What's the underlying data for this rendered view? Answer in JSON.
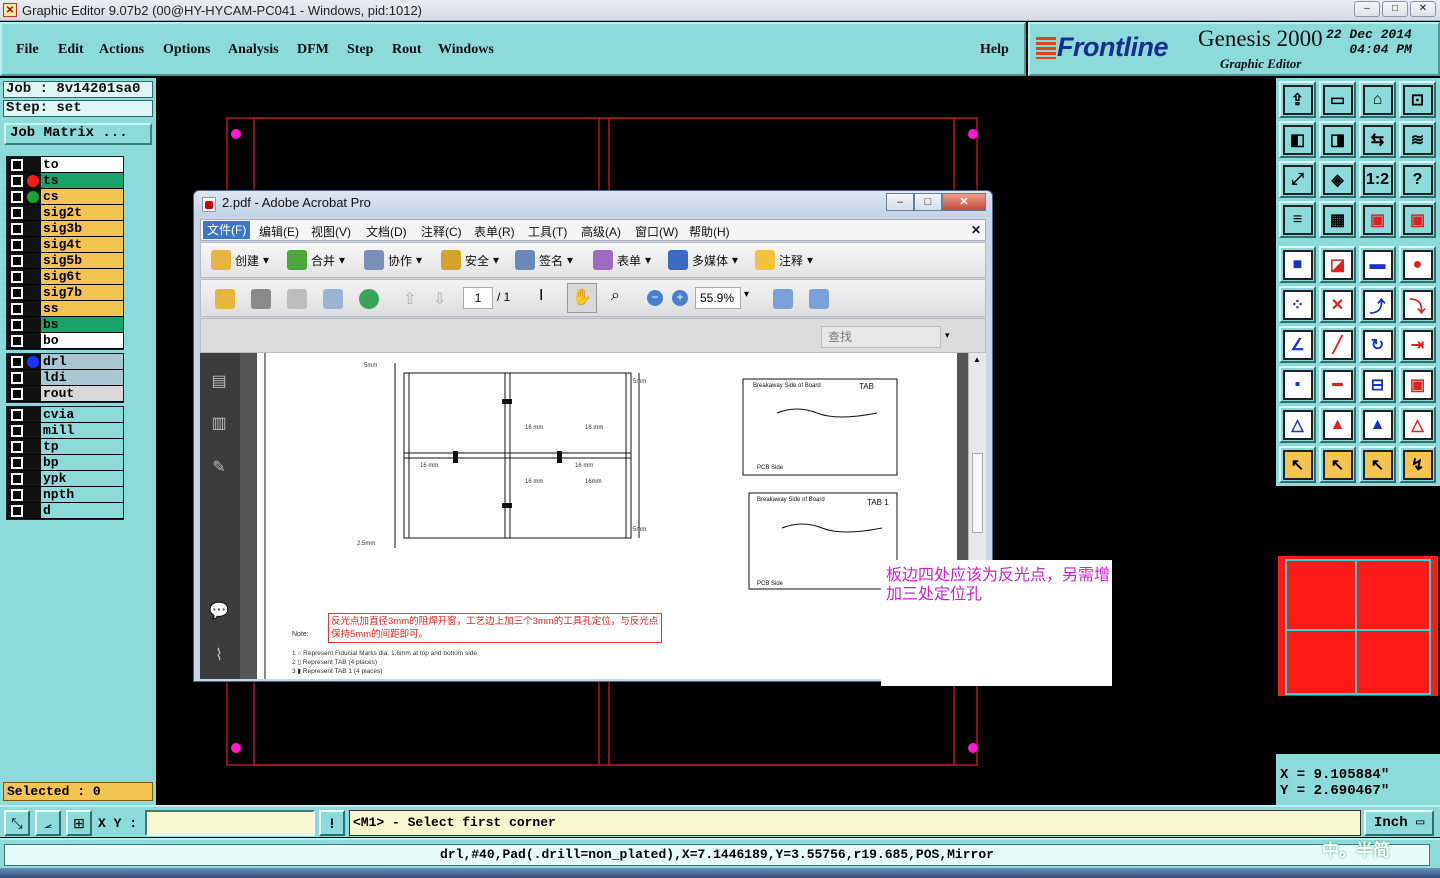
{
  "window": {
    "title": "Graphic Editor 9.07b2 (00@HY-HYCAM-PC041 - Windows, pid:1012)",
    "controls": [
      "–",
      "□",
      "✕"
    ]
  },
  "menu": {
    "items": [
      "File",
      "Edit",
      "Actions",
      "Options",
      "Analysis",
      "DFM",
      "Step",
      "Rout",
      "Windows"
    ],
    "help": "Help"
  },
  "brand": {
    "logo": "Frontline",
    "product": "Genesis 2000",
    "subtitle": "Graphic Editor",
    "date": "22 Dec 2014",
    "time": "04:04 PM"
  },
  "job": {
    "job_label": "Job : 8v14201sa0",
    "step_label": "Step: set",
    "matrix_button": "Job Matrix ..."
  },
  "layers": {
    "group1": [
      {
        "name": "to",
        "color": "#ffffff",
        "dot": ""
      },
      {
        "name": "ts",
        "color": "#1aa36a",
        "dot": "#ff1a1a"
      },
      {
        "name": "cs",
        "color": "#f4c450",
        "dot": "#1aa336"
      },
      {
        "name": "sig2t",
        "color": "#f4c450",
        "dot": ""
      },
      {
        "name": "sig3b",
        "color": "#f4c450",
        "dot": ""
      },
      {
        "name": "sig4t",
        "color": "#f4c450",
        "dot": ""
      },
      {
        "name": "sig5b",
        "color": "#f4c450",
        "dot": ""
      },
      {
        "name": "sig6t",
        "color": "#f4c450",
        "dot": ""
      },
      {
        "name": "sig7b",
        "color": "#f4c450",
        "dot": ""
      },
      {
        "name": "ss",
        "color": "#f4c450",
        "dot": ""
      },
      {
        "name": "bs",
        "color": "#1aa36a",
        "dot": ""
      },
      {
        "name": "bo",
        "color": "#ffffff",
        "dot": ""
      }
    ],
    "group2": [
      {
        "name": "drl",
        "color": "#a9c7d3",
        "dot": "#1a33ff"
      },
      {
        "name": "ldi",
        "color": "#a9c7d3",
        "dot": ""
      },
      {
        "name": "rout",
        "color": "#d8d8d8",
        "dot": ""
      }
    ],
    "group3": [
      {
        "name": "cvia",
        "color": "#8ddada",
        "dot": ""
      },
      {
        "name": "mill",
        "color": "#8ddada",
        "dot": ""
      },
      {
        "name": "tp",
        "color": "#8ddada",
        "dot": ""
      },
      {
        "name": "bp",
        "color": "#8ddada",
        "dot": ""
      },
      {
        "name": "ypk",
        "color": "#8ddada",
        "dot": ""
      },
      {
        "name": "npth",
        "color": "#8ddada",
        "dot": ""
      },
      {
        "name": "d",
        "color": "#8ddada",
        "dot": ""
      }
    ]
  },
  "selected": "Selected : 0",
  "coords": {
    "x": "X = 9.105884\"",
    "y": "Y = 2.690467\""
  },
  "command": {
    "xy_label": "X Y :",
    "xy_value": "",
    "alert_icon": "!",
    "prompt": "<M1> - Select first corner",
    "unit": "Inch"
  },
  "status": "drl,#40,Pad(.drill=non_plated),X=7.1446189,Y=3.55756,r19.685,POS,Mirror",
  "watermark": "中。半简",
  "acrobat": {
    "title": "2.pdf - Adobe Acrobat Pro",
    "menu": [
      "文件(F)",
      "编辑(E)",
      "视图(V)",
      "文档(D)",
      "注释(C)",
      "表单(R)",
      "工具(T)",
      "高级(A)",
      "窗口(W)",
      "帮助(H)"
    ],
    "toolbar1": [
      "创建",
      "合并",
      "协作",
      "安全",
      "签名",
      "表单",
      "多媒体",
      "注释"
    ],
    "page_current": "1",
    "page_total": "/ 1",
    "zoom": "55.9%",
    "search_placeholder": "查找",
    "doc": {
      "red_note": "反光点加直径3mm的阻焊开窗，工艺边上加三个3mm的工具孔定位，与反光点保持5mm的间距即可。",
      "note_label": "Note:",
      "notes": [
        "1   ○   Represent Fiducial Marks dia. 1.6mm at top and bottom side",
        "2   ▯   Represent TAB (4 places)",
        "3   ▮   Represent TAB 1 (4 places)"
      ],
      "tab_label": "TAB",
      "tab1_label": "TAB 1",
      "breakaway": "Breakaway Side of Board",
      "pcb_side": "PCB Side"
    }
  },
  "annotation": "板边四处应该为反光点，另需增加三处定位孔"
}
